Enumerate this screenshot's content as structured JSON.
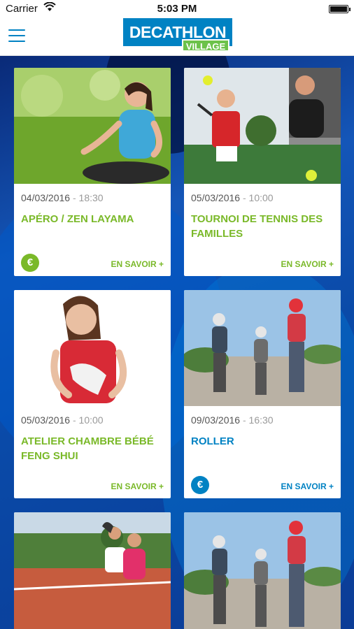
{
  "status_bar": {
    "carrier": "Carrier",
    "time": "5:03 PM"
  },
  "header": {
    "logo_main": "DECATHLON",
    "logo_sub": "VILLAGE",
    "menu_icon": "hamburger-menu-icon"
  },
  "colors": {
    "brand_blue": "#0082c3",
    "brand_green": "#7ab929"
  },
  "events": [
    {
      "date": "04/03/2016",
      "separator": " - ",
      "time": "18:30",
      "title": "APÉRO / ZEN LAYAMA",
      "price_symbol": "€",
      "more": "EN SAVOIR +",
      "theme": "green"
    },
    {
      "date": "05/03/2016",
      "separator": " - ",
      "time": "10:00",
      "title": "TOURNOI DE TENNIS DES FAMILLES",
      "more": "EN SAVOIR +",
      "theme": "green"
    },
    {
      "date": "05/03/2016",
      "separator": " - ",
      "time": "10:00",
      "title": "ATELIER CHAMBRE BÉBÉ FENG SHUI",
      "more": "EN SAVOIR +",
      "theme": "green"
    },
    {
      "date": "09/03/2016",
      "separator": " - ",
      "time": "16:30",
      "title": "ROLLER",
      "price_symbol": "€",
      "more": "EN SAVOIR +",
      "theme": "blue"
    }
  ]
}
